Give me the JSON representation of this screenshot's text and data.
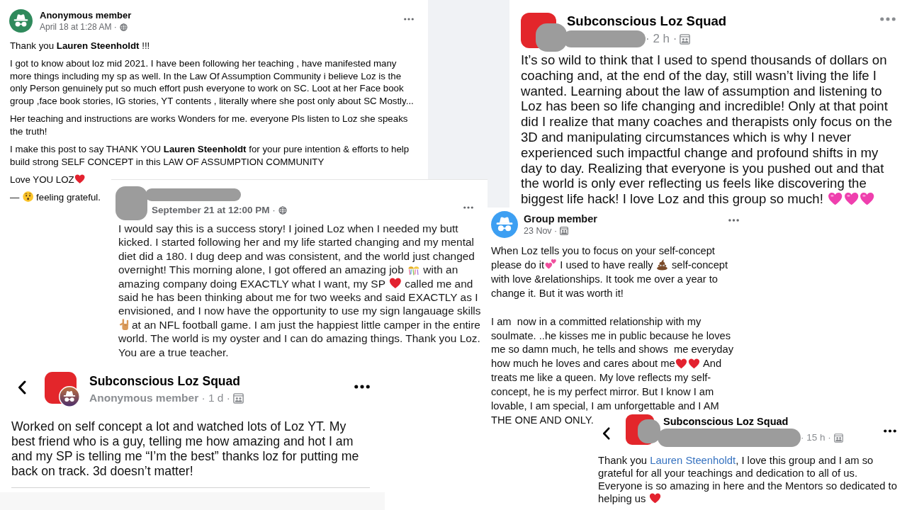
{
  "posts": [
    {
      "avatar": {
        "kind": "incognito",
        "color": "#2f8a5c"
      },
      "title": "Anonymous member",
      "meta": "April 18 at 1:28 AM ·",
      "audience": {
        "kind": "public"
      },
      "paragraphs": [
        {
          "parts": [
            {
              "kind": "text",
              "text": "Thank you **Lauren Steenholdt** !!!"
            }
          ]
        },
        {
          "parts": [
            {
              "kind": "text",
              "text": "I got to know about loz mid 2021. I have been following her teaching , have manifested many more things including my sp as well. In the Law Of Assumption Community i believe Loz is the only Person genuinely put so much effort push everyone to work on SC. Loot at her Face book group ,face book stories, IG stories, YT contents , literally where she post only about SC Mostly..."
            }
          ]
        },
        {
          "parts": [
            {
              "kind": "text",
              "text": "Her teaching and instructions are works Wonders for me. everyone Pls listen to Loz she speaks the truth!"
            }
          ]
        },
        {
          "parts": [
            {
              "kind": "text",
              "text": "I make this post to say THANK YOU **Lauren Steenholdt** for your pure intention & efforts to help build strong SELF CONCEPT in this LAW OF ASSUMPTION COMMUNITY"
            }
          ]
        },
        {
          "parts": [
            {
              "kind": "text",
              "text": "Love YOU LOZ"
            },
            {
              "kind": "heart"
            }
          ]
        },
        {
          "parts": [
            {
              "kind": "text",
              "text": "— "
            },
            {
              "kind": "face"
            },
            {
              "kind": "text",
              "text": " feeling grateful."
            }
          ]
        }
      ]
    },
    {
      "avatar": {
        "kind": "group"
      },
      "redacted": true,
      "title": "Subconscious Loz Squad",
      "meta": "· 2 h ·",
      "audience": {
        "kind": "group"
      },
      "paragraphs": [
        {
          "parts": [
            {
              "kind": "text",
              "text": "It’s so wild to think that I used to spend thousands of dollars on coaching and, at the end of the day, still wasn’t living the life I wanted. Learning about the law of assumption and listening to Loz has been so life changing and incredible! Only at that point did I realize that many coaches and therapists only focus on the 3D and manipulating circumstances which is why I never experienced such impactful change and profound shifts in my day to day. Realizing that everyone is you pushed out and that the world is only ever reflecting us feels like discovering the biggest life hack! I love Loz and this group so much! "
            },
            {
              "kind": "pinkheart"
            },
            {
              "kind": "pinkheart"
            },
            {
              "kind": "pinkheart"
            }
          ]
        }
      ]
    },
    {
      "redacted": true,
      "meta": "**September 21 at 12:00 PM** ·",
      "audience": {
        "kind": "public"
      },
      "paragraphs": [
        {
          "parts": [
            {
              "kind": "text",
              "text": "I would say this is a success story! I joined Loz when I needed my butt kicked. I started following her and my life started changing and my mental diet did a 180. I dug deep and was consistent, and the world just changed overnight! This morning alone, I got offered an amazing job "
            },
            {
              "kind": "confetti"
            },
            {
              "kind": "text",
              "text": " with an amazing company doing EXACTLY what I want, my SP "
            },
            {
              "kind": "heart"
            },
            {
              "kind": "text",
              "text": " called me and said he has been thinking about me for two weeks and said EXACTLY as I envisioned, and I now have the opportunity to use my sign langauage skills "
            },
            {
              "kind": "handsign"
            },
            {
              "kind": "text",
              "text": "at an NFL football game. I am just the happiest little camper in the entire world. The world is my oyster and I can do amazing things. Thank you Loz. You are a true teacher."
            }
          ]
        }
      ]
    },
    {
      "avatar": {
        "kind": "incognito",
        "color": "#3d9ff2"
      },
      "title": "Group member",
      "meta": "23 Nov ·",
      "audience": {
        "kind": "group"
      },
      "paragraphs": [
        {
          "parts": [
            {
              "kind": "text",
              "text": "When Loz tells you to focus on your self-concept please do it"
            },
            {
              "kind": "twohearts"
            },
            {
              "kind": "text",
              "text": " I used to have really "
            },
            {
              "kind": "poo"
            },
            {
              "kind": "text",
              "text": " self-concept with love &relationships. It took me over a year to change it. But it was worth it!"
            }
          ]
        },
        {
          "parts": [
            {
              "kind": "text",
              "text": "I am  now in a committed relationship with my soulmate. ..he kisses me in public because he loves me so damn much, he tells and shows  me everyday how much he loves and cares about me"
            },
            {
              "kind": "heart"
            },
            {
              "kind": "heart"
            },
            {
              "kind": "text",
              "text": " And treats me like a queen. My love reflects my self-concept, he is my perfect mirror. But I know I am lovable, I am special, I am unforgettable and I AM THE ONE AND ONLY."
            }
          ]
        }
      ]
    },
    {
      "back_button": true,
      "avatar": {
        "kind": "group"
      },
      "anonymous_badge": true,
      "title": "Subconscious Loz Squad",
      "meta": "**Anonymous member** · 1 d ·",
      "audience": {
        "kind": "group"
      },
      "paragraphs": [
        {
          "parts": [
            {
              "kind": "text",
              "text": "Worked on self concept a lot and watched lots of Loz YT. My best friend who is a guy, telling me how amazing and hot I am and my SP is telling me “I’m the best” thanks loz for putting me back on track. 3d doesn’t matter!"
            }
          ]
        }
      ]
    },
    {
      "back_button": true,
      "avatar": {
        "kind": "group"
      },
      "redacted": true,
      "title": "Subconscious Loz Squad",
      "meta": "· 15 h ·",
      "audience": {
        "kind": "group"
      },
      "paragraphs": [
        {
          "parts": [
            {
              "kind": "text",
              "text": "Thank you "
            },
            {
              "kind": "link",
              "text": "Lauren Steenholdt"
            },
            {
              "kind": "text",
              "text": ", I love this group and I am so grateful for all your teachings and dedication to all of us. Everyone is so amazing in here and the Mentors so dedicated to helping us "
            },
            {
              "kind": "heart"
            }
          ]
        }
      ]
    }
  ]
}
